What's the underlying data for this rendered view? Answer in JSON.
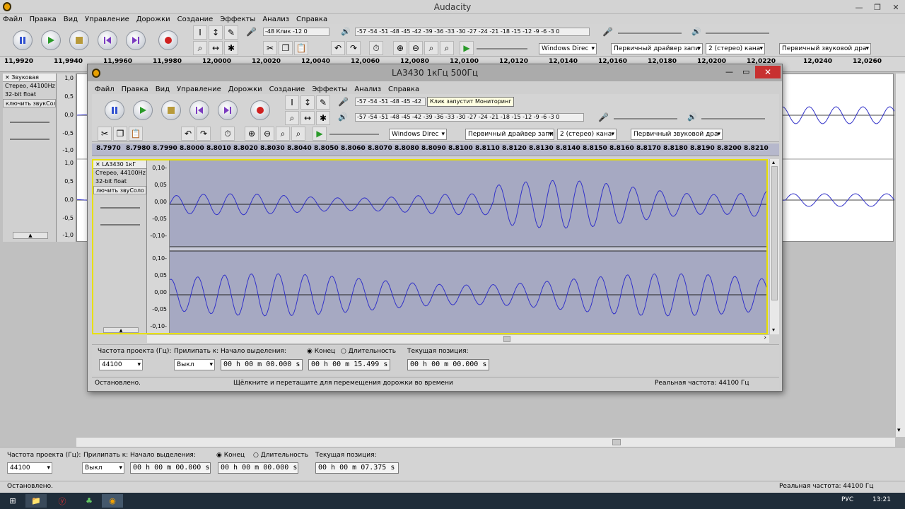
{
  "main": {
    "title": "Audacity",
    "menu": [
      "Файл",
      "Правка",
      "Вид",
      "Управление",
      "Дорожки",
      "Создание",
      "Эффекты",
      "Анализ",
      "Справка"
    ],
    "rec_meter": "-48  Клик  -12  0",
    "play_meter": "-57 -54 -51 -48 -45 -42 -39 -36 -33 -30 -27 -24 -21 -18 -15 -12 -9  -6  -3  0",
    "device_host": "Windows Direc",
    "device_in": "Первичный драйвер запи",
    "channels": "2 (стерео) кана",
    "device_out": "Первичный звуковой дра",
    "ruler": [
      "11,9920",
      "11,9940",
      "11,9960",
      "11,9980",
      "12,0000",
      "12,0020",
      "12,0040",
      "12,0060",
      "12,0080",
      "12,0100",
      "12,0120",
      "12,0140",
      "12,0160",
      "12,0180",
      "12,0200",
      "12,0220",
      "12,0240",
      "12,0260"
    ],
    "track_name": "Звуковая",
    "track_info": [
      "Стерео, 44100Hz",
      "32-bit float"
    ],
    "mute_solo": "ключить звукСоло",
    "scale": [
      "1,0",
      "0,5",
      "0,0",
      "-0,5",
      "-1,0"
    ],
    "rate_label": "Частота проекта (Гц):",
    "rate_value": "44100",
    "snap_label": "Прилипать к:",
    "snap_value": "Выкл",
    "sel_start_label": "Начало выделения:",
    "end_label": "Конец",
    "length_label": "Длительность",
    "pos_label": "Текущая позиция:",
    "sel_start": "00 h 00 m 00.000 s",
    "sel_end": "00 h 00 m 00.000 s",
    "position": "00 h 00 m 07.375 s",
    "status_left": "Остановлено.",
    "status_right": "Реальная частота: 44100 Гц"
  },
  "second": {
    "title": "LA3430 1кГц 500Гц",
    "menu": [
      "Файл",
      "Правка",
      "Вид",
      "Управление",
      "Дорожки",
      "Создание",
      "Эффекты",
      "Анализ",
      "Справка"
    ],
    "rec_meter": "-57 -54 -51 -48 -45 -42",
    "tooltip": "Клик запустит Мониторинг",
    "play_meter": "-57 -54 -51 -48 -45 -42 -39 -36 -33 -30 -27 -24 -21 -18 -15 -12  -9  -6  -3  0",
    "device_host": "Windows Direc",
    "device_in": "Первичный драйвер запи",
    "channels": "2 (стерео) кана",
    "device_out": "Первичный звуковой дра",
    "ruler": [
      "8.7970",
      "8.7980",
      "8.7990",
      "8.8000",
      "8.8010",
      "8.8020",
      "8.8030",
      "8.8040",
      "8.8050",
      "8.8060",
      "8.8070",
      "8.8080",
      "8.8090",
      "8.8100",
      "8.8110",
      "8.8120",
      "8.8130",
      "8.8140",
      "8.8150",
      "8.8160",
      "8.8170",
      "8.8180",
      "8.8190",
      "8.8200",
      "8.8210"
    ],
    "track_name": "LA3430 1кГ",
    "track_info": [
      "Стерео, 44100Hz",
      "32-bit float"
    ],
    "mute_solo": "лючить звуСоло",
    "scale": [
      "0,10-",
      "0,05",
      "0,00",
      "-0,05",
      "-0,10-"
    ],
    "rate_label": "Частота проекта (Гц):",
    "rate_value": "44100",
    "snap_label": "Прилипать к:",
    "snap_value": "Выкл",
    "sel_start_label": "Начало выделения:",
    "end_label": "Конец",
    "length_label": "Длительность",
    "pos_label": "Текущая позиция:",
    "sel_start": "00 h 00 m 00.000 s",
    "sel_end": "00 h 00 m 15.499 s",
    "position": "00 h 00 m 00.000 s",
    "status_left": "Остановлено.",
    "status_mid": "Щёлкните и перетащите для перемещения дорожки во времени",
    "status_right": "Реальная частота: 44100 Гц"
  },
  "taskbar": {
    "lang": "РУС",
    "clock": "13:21"
  },
  "colors": {
    "wave": "#3232c8",
    "sel_bg": "#a6a9c2",
    "selected_border": "#e8e000"
  }
}
